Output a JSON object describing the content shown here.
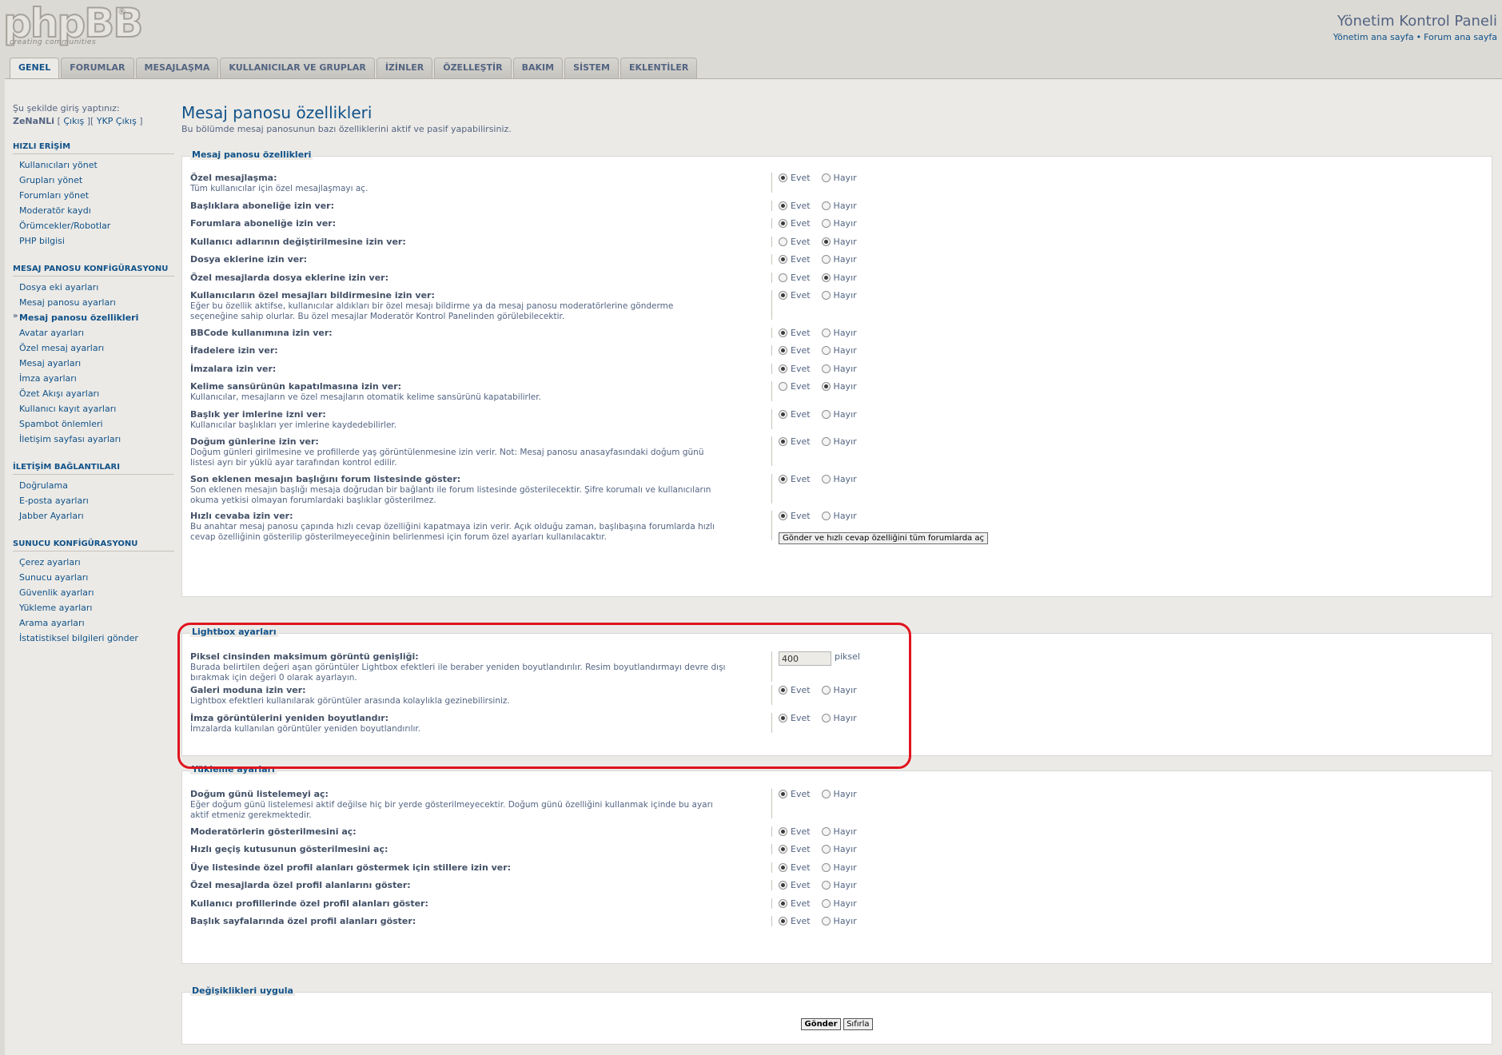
{
  "header": {
    "logo_text": "phpBB",
    "logo_tagline": "creating communities",
    "logo_reg": "®",
    "title": "Yönetim Kontrol Paneli",
    "links": [
      "Yönetim ana sayfa",
      "Forum ana sayfa"
    ],
    "link_sep": "•"
  },
  "tabs": [
    {
      "label": "GENEL",
      "active": true
    },
    {
      "label": "FORUMLAR"
    },
    {
      "label": "MESAJLAŞMA"
    },
    {
      "label": "KULLANICILAR VE GRUPLAR"
    },
    {
      "label": "İZİNLER"
    },
    {
      "label": "ÖZELLEŞTİR"
    },
    {
      "label": "BAKIM"
    },
    {
      "label": "SİSTEM"
    },
    {
      "label": "EKLENTİLER"
    }
  ],
  "sidebar": {
    "login_text": "Şu şekilde giriş yaptınız:",
    "username": "ZeNaNLi",
    "logout": "Çıkış",
    "ykp_logout": "YKP Çıkış",
    "sections": [
      {
        "title": "HIZLI ERİŞİM",
        "items": [
          "Kullanıcıları yönet",
          "Grupları yönet",
          "Forumları yönet",
          "Moderatör kaydı",
          "Örümcekler/Robotlar",
          "PHP bilgisi"
        ]
      },
      {
        "title": "MESAJ PANOSU KONFİGÜRASYONU",
        "items": [
          "Dosya eki ayarları",
          "Mesaj panosu ayarları",
          "Mesaj panosu özellikleri",
          "Avatar ayarları",
          "Özel mesaj ayarları",
          "Mesaj ayarları",
          "İmza ayarları",
          "Özet Akışı ayarları",
          "Kullanıcı kayıt ayarları",
          "Spambot önlemleri",
          "İletişim sayfası ayarları"
        ],
        "active": 2
      },
      {
        "title": "İLETİŞİM BAĞLANTILARI",
        "items": [
          "Doğrulama",
          "E-posta ayarları",
          "Jabber Ayarları"
        ]
      },
      {
        "title": "SUNUCU KONFİGÜRASYONU",
        "items": [
          "Çerez ayarları",
          "Sunucu ayarları",
          "Güvenlik ayarları",
          "Yükleme ayarları",
          "Arama ayarları",
          "İstatistiksel bilgileri gönder"
        ]
      }
    ]
  },
  "page": {
    "title": "Mesaj panosu özellikleri",
    "description": "Bu bölümde mesaj panosunun bazı özelliklerini aktif ve pasif yapabilirsiniz."
  },
  "radio_labels": {
    "yes": "Evet",
    "no": "Hayır"
  },
  "fieldsets": {
    "board": {
      "legend": "Mesaj panosu özellikleri",
      "rows": [
        {
          "title": "Özel mesajlaşma:",
          "desc": [
            "Tüm kullanıcılar için özel mesajlaşmayı aç."
          ],
          "value": "yes"
        },
        {
          "title": "Başlıklara aboneliğe izin ver:",
          "desc": [],
          "value": "yes"
        },
        {
          "title": "Forumlara aboneliğe izin ver:",
          "desc": [],
          "value": "yes"
        },
        {
          "title": "Kullanıcı adlarının değiştirilmesine izin ver:",
          "desc": [],
          "value": "no"
        },
        {
          "title": "Dosya eklerine izin ver:",
          "desc": [],
          "value": "yes"
        },
        {
          "title": "Özel mesajlarda dosya eklerine izin ver:",
          "desc": [],
          "value": "no"
        },
        {
          "title": "Kullanıcıların özel mesajları bildirmesine izin ver:",
          "desc": [
            "Eğer bu özellik aktifse, kullanıcılar aldıkları bir özel mesajı bildirme ya da mesaj panosu moderatörlerine gönderme",
            "seçeneğine sahip olurlar. Bu özel mesajlar Moderatör Kontrol Panelinden görülebilecektir."
          ],
          "value": "yes"
        },
        {
          "title": "BBCode kullanımına izin ver:",
          "desc": [],
          "value": "yes"
        },
        {
          "title": "İfadelere izin ver:",
          "desc": [],
          "value": "yes"
        },
        {
          "title": "İmzalara izin ver:",
          "desc": [],
          "value": "yes"
        },
        {
          "title": "Kelime sansürünün kapatılmasına izin ver:",
          "desc": [
            "Kullanıcılar, mesajların ve özel mesajların otomatik kelime sansürünü kapatabilirler."
          ],
          "value": "no"
        },
        {
          "title": "Başlık yer imlerine izni ver:",
          "desc": [
            "Kullanıcılar başlıkları yer imlerine kaydedebilirler."
          ],
          "value": "yes"
        },
        {
          "title": "Doğum günlerine izin ver:",
          "desc": [
            "Doğum günleri girilmesine ve profillerde yaş görüntülenmesine izin verir. Not: Mesaj panosu anasayfasındaki doğum günü",
            "listesi ayrı bir yüklü ayar tarafından kontrol edilir."
          ],
          "value": "yes"
        },
        {
          "title": "Son eklenen mesajın başlığını forum listesinde göster:",
          "desc": [
            "Son eklenen mesajın başlığı mesaja doğrudan bir bağlantı ile forum listesinde gösterilecektir. Şifre korumalı ve kullanıcıların",
            "okuma yetkisi olmayan forumlardaki başlıklar gösterilmez."
          ],
          "value": "yes"
        },
        {
          "title": "Hızlı cevaba izin ver:",
          "desc": [
            "Bu anahtar mesaj panosu çapında hızlı cevap özelliğini kapatmaya izin verir. Açık olduğu zaman, başlıbaşına forumlarda hızlı",
            "cevap özelliğinin gösterilip gösterilmeyeceğinin belirlenmesi için forum özel ayarları kullanılacaktır."
          ],
          "value": "yes",
          "button": "Gönder ve hızlı cevap özelliğini tüm forumlarda aç"
        }
      ]
    },
    "lightbox": {
      "legend": "Lightbox ayarları",
      "max_width": {
        "title": "Piksel cinsinden maksimum görüntü genişliği:",
        "desc": [
          "Burada belirtilen değeri aşan görüntüler Lightbox efektleri ile beraber yeniden boyutlandırılır. Resim boyutlandırmayı devre dışı",
          "bırakmak için değeri 0 olarak ayarlayın."
        ],
        "value": "400",
        "unit": "piksel"
      },
      "rows": [
        {
          "title": "Galeri moduna izin ver:",
          "desc": [
            "Lightbox efektleri kullanılarak görüntüler arasında kolaylıkla gezinebilirsiniz."
          ],
          "value": "yes"
        },
        {
          "title": "İmza görüntülerini yeniden boyutlandır:",
          "desc": [
            "İmzalarda kullanılan görüntüler yeniden boyutlandırılır."
          ],
          "value": "yes"
        }
      ]
    },
    "load": {
      "legend": "Yükleme ayarları",
      "rows": [
        {
          "title": "Doğum günü listelemeyi aç:",
          "desc": [
            "Eğer doğum günü listelemesi aktif değilse hiç bir yerde gösterilmeyecektir. Doğum günü özelliğini kullanmak içinde bu ayarı",
            "aktif etmeniz gerekmektedir."
          ],
          "value": "yes"
        },
        {
          "title": "Moderatörlerin gösterilmesini aç:",
          "desc": [],
          "value": "yes"
        },
        {
          "title": "Hızlı geçiş kutusunun gösterilmesini aç:",
          "desc": [],
          "value": "yes"
        },
        {
          "title": "Üye listesinde özel profil alanları göstermek için stillere izin ver:",
          "desc": [],
          "value": "yes"
        },
        {
          "title": "Özel mesajlarda özel profil alanlarını göster:",
          "desc": [],
          "value": "yes"
        },
        {
          "title": "Kullanıcı profillerinde özel profil alanları göster:",
          "desc": [],
          "value": "yes"
        },
        {
          "title": "Başlık sayfalarında özel profil alanları göster:",
          "desc": [],
          "value": "yes"
        }
      ]
    },
    "submit": {
      "legend": "Değişiklikleri uygula",
      "submit_label": "Gönder",
      "reset_label": "Sıfırla"
    }
  },
  "colors": {
    "accent": "#105289",
    "text": "#536482",
    "highlight": "#e0141e"
  }
}
